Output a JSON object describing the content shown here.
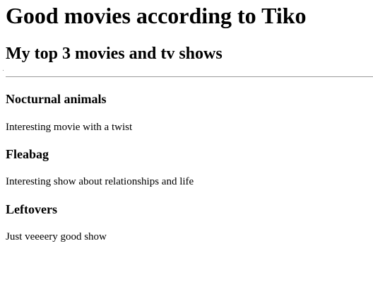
{
  "page": {
    "title": "Good movies according to Tiko",
    "subtitle": "My top 3 movies and tv shows"
  },
  "items": [
    {
      "title": "Nocturnal animals",
      "description": "Interesting movie with a twist"
    },
    {
      "title": "Fleabag",
      "description": "Interesting show about relationships and life"
    },
    {
      "title": "Leftovers",
      "description": "Just veeeery good show"
    }
  ]
}
